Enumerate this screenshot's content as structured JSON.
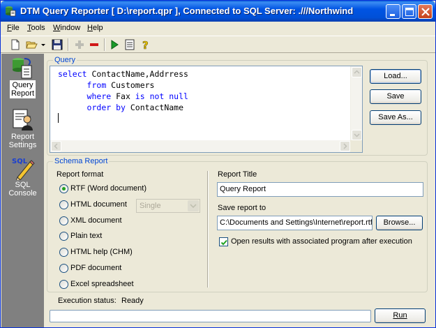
{
  "window": {
    "title": "DTM Query Reporter [ D:\\report.qpr ], Connected to SQL Server: .///Northwind"
  },
  "menu": {
    "file": {
      "first": "F",
      "rest": "ile"
    },
    "tools": {
      "first": "T",
      "rest": "ools"
    },
    "window": {
      "first": "W",
      "rest": "indow"
    },
    "help": {
      "first": "H",
      "rest": "elp"
    }
  },
  "toolbar": {
    "icons": [
      "new-icon",
      "open-icon",
      "save-icon",
      "add-icon",
      "remove-icon",
      "run-icon",
      "list-icon",
      "help-icon"
    ]
  },
  "nav": {
    "items": [
      {
        "name": "query-report",
        "line1": "Query",
        "line2": "Report",
        "active": true
      },
      {
        "name": "report-settings",
        "line1": "Report",
        "line2": "Settings",
        "active": false
      },
      {
        "name": "sql-console",
        "line1": "SQL",
        "line2": "Console",
        "active": false
      }
    ]
  },
  "query": {
    "group_title": "Query",
    "lines": [
      {
        "kw1": "select",
        "t1": " ContactName,Addrress",
        "indent": ""
      },
      {
        "kw1": "from",
        "t1": " Customers",
        "indent": "      "
      },
      {
        "kw1": "where",
        "t1": " Fax ",
        "kw2": "is not null",
        "indent": "      "
      },
      {
        "kw1": "order by",
        "t1": " ContactName",
        "indent": "      "
      }
    ],
    "load_label": "Load...",
    "save_label": "Save",
    "save_as_label": "Save As..."
  },
  "schema": {
    "group_title": "Schema Report",
    "format_label": "Report format",
    "formats": [
      {
        "label": "RTF (Word document)",
        "checked": true
      },
      {
        "label": "HTML document",
        "checked": false
      },
      {
        "label": "XML document",
        "checked": false
      },
      {
        "label": "Plain text",
        "checked": false
      },
      {
        "label": "HTML help (CHM)",
        "checked": false
      },
      {
        "label": "PDF document",
        "checked": false
      },
      {
        "label": "Excel spreadsheet",
        "checked": false
      }
    ],
    "html_mode": "Single",
    "report_title_label": "Report Title",
    "report_title_value": "Query Report",
    "save_to_label": "Save report to",
    "save_to_value": "C:\\Documents and Settings\\Internet\\report.rtf",
    "browse_label": "Browse...",
    "open_results_label": "Open results with associated program after execution",
    "open_results_checked": true
  },
  "status": {
    "label": "Execution status:",
    "value": "Ready",
    "run_label": "Run",
    "progress": 0
  }
}
